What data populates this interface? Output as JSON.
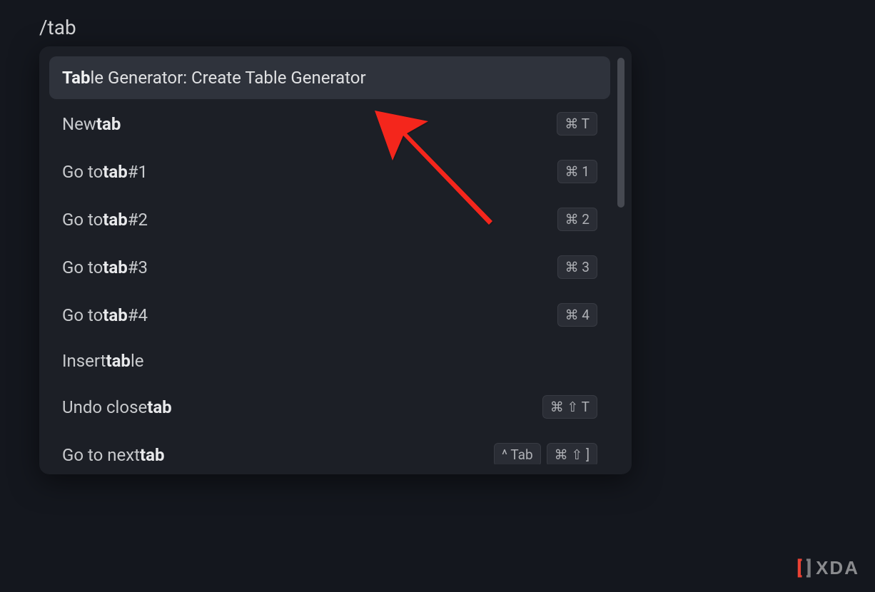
{
  "search_query": "/tab",
  "palette": {
    "items": [
      {
        "pre": "",
        "bold": "Tab",
        "post": "le Generator: Create Table Generator",
        "shortcuts": [],
        "selected": true
      },
      {
        "pre": "New ",
        "bold": "tab",
        "post": "",
        "shortcuts": [
          "⌘ T"
        ],
        "selected": false
      },
      {
        "pre": "Go to ",
        "bold": "tab",
        "post": " #1",
        "shortcuts": [
          "⌘ 1"
        ],
        "selected": false
      },
      {
        "pre": "Go to ",
        "bold": "tab",
        "post": " #2",
        "shortcuts": [
          "⌘ 2"
        ],
        "selected": false
      },
      {
        "pre": "Go to ",
        "bold": "tab",
        "post": " #3",
        "shortcuts": [
          "⌘ 3"
        ],
        "selected": false
      },
      {
        "pre": "Go to ",
        "bold": "tab",
        "post": " #4",
        "shortcuts": [
          "⌘ 4"
        ],
        "selected": false
      },
      {
        "pre": "Insert ",
        "bold": "tab",
        "post": "le",
        "shortcuts": [],
        "selected": false
      },
      {
        "pre": "Undo close ",
        "bold": "tab",
        "post": "",
        "shortcuts": [
          "⌘ ⇧ T"
        ],
        "selected": false
      },
      {
        "pre": "Go to next ",
        "bold": "tab",
        "post": "",
        "shortcuts": [
          "^ Tab",
          "⌘ ⇧ ]"
        ],
        "selected": false
      }
    ]
  },
  "logo": {
    "text": "XDA"
  }
}
